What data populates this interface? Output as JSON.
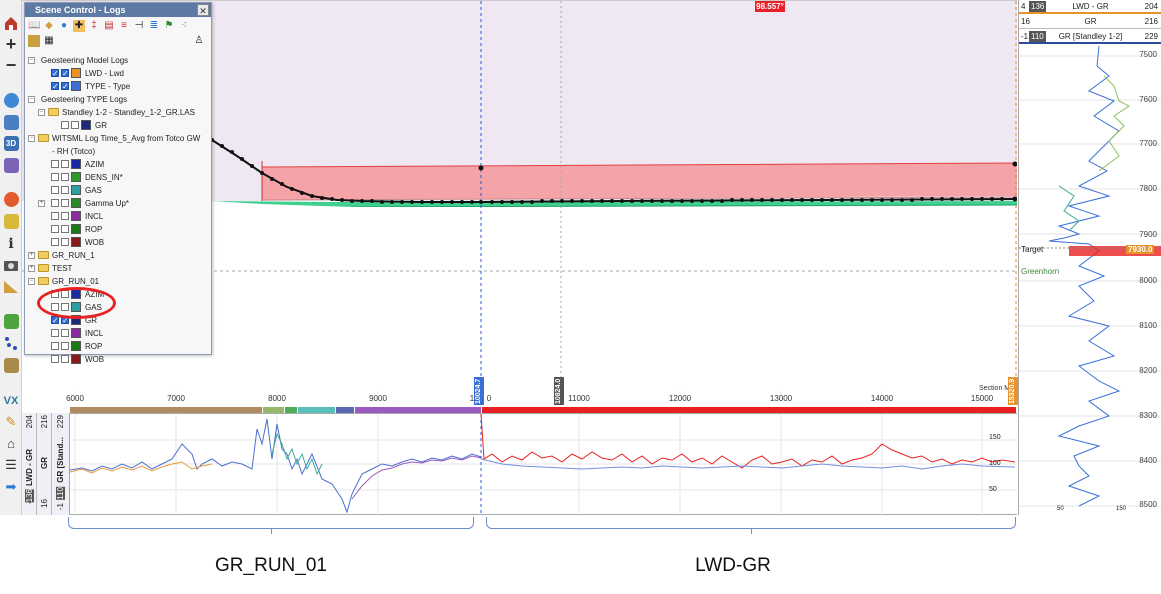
{
  "scene_control": {
    "title": "Scene Control - Logs",
    "close_label": "✕",
    "tree": {
      "geosteering_model_logs": "Geosteering Model Logs",
      "lwd": "LWD - Lwd",
      "type": "TYPE - Type",
      "geosteering_type_logs": "Geosteering TYPE Logs",
      "standley": "Standley 1-2 - Standley_1-2_GR.LAS",
      "gr": "GR",
      "witsml_1": "WITSML Log Time_5_Avg from Totco GW",
      "witsml_2": "- RH (Totco)",
      "azim": "AZIM",
      "dens_in": "DENS_IN*",
      "gas": "GAS",
      "gamma_up": "Gamma Up*",
      "incl": "INCL",
      "rop": "ROP",
      "wob": "WOB",
      "gr_run_1": "GR_RUN_1",
      "test": "TEST",
      "gr_run_01": "GR_RUN_01",
      "azim2": "AZIM",
      "gas2": "GAS",
      "gr2": "GR",
      "incl2": "INCL",
      "rop2": "ROP",
      "wob2": "WOB"
    }
  },
  "section_view": {
    "flag_value": "98.557°",
    "x_axis_title": "Section MD (ft)",
    "x_ticks": [
      "6000",
      "7000",
      "8000",
      "9000",
      "1",
      "0",
      "11000",
      "12000",
      "13000",
      "14000",
      "15000"
    ],
    "marker_blue": "10024.7",
    "marker_grey": "10824.0",
    "marker_orange": "15320.9"
  },
  "log_track": {
    "lwd_label": "LWD - GR",
    "lwd_val": "204",
    "gr_label": "GR",
    "gr_val": "216",
    "standley_label": "GR [Stand...",
    "standley_val": "229",
    "left_n1": "4",
    "left_n2": "136",
    "left_n3": "16",
    "left_n4": "-1",
    "left_n5": "110",
    "scale_150": "150",
    "scale_100": "100",
    "scale_50": "50"
  },
  "right_panel": {
    "row1_n1": "4",
    "row1_badge": "136",
    "row1_title": "LWD - GR",
    "row1_n2": "204",
    "row2_n1": "16",
    "row2_title": "GR",
    "row2_n2": "216",
    "row3_n1": "-1",
    "row3_badge": "110",
    "row3_title": "GR [Standley 1-2]",
    "row3_n2": "229",
    "depths": [
      "7500",
      "7600",
      "7700",
      "7800",
      "7900",
      "8000",
      "8100",
      "8200",
      "8300",
      "8400",
      "8500"
    ],
    "target_label": "Target",
    "target_value": "7930.0",
    "formation_label": "Greenhorn",
    "bottom_scale_left": "50",
    "bottom_scale_right": "150"
  },
  "annotations": {
    "left_label": "GR_RUN_01",
    "right_label": "LWD-GR"
  },
  "colors": {
    "model_pink": "#f4a3a8",
    "model_pink_line": "#e04040",
    "panel_header": "#5c7aa3",
    "lwd_red": "#e82020",
    "gr_blue": "#4f7fd9",
    "annotation_red": "#e82222",
    "bracket_blue": "#6c8ec9"
  }
}
